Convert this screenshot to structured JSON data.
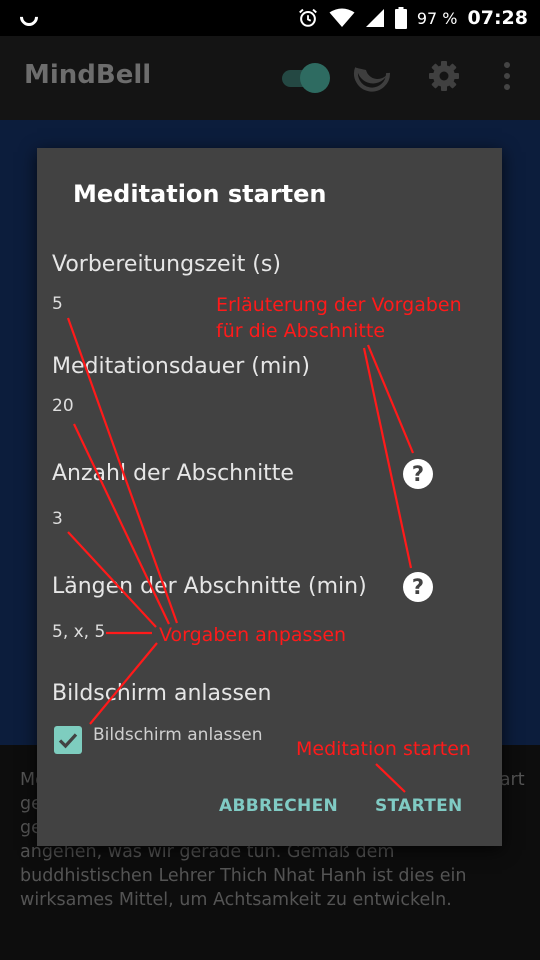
{
  "status_bar": {
    "battery_percent": "97 %",
    "time": "07:28"
  },
  "app_bar": {
    "title": "MindBell"
  },
  "background_text": "Meditation ist eine Übung, die im Alltag in der Gegenwart geschieht. Wir sind immer damit beschäftigt, was wir gerade tun, und in welchem Geisteszustand wir das angehen, was wir gerade tun. Gemäß dem buddhistischen Lehrer Thich Nhat Hanh ist dies ein wirksames Mittel, um Achtsamkeit zu entwickeln.",
  "dialog": {
    "title": "Meditation starten",
    "prefs": [
      {
        "title": "Vorbereitungszeit (s)",
        "value": "5"
      },
      {
        "title": "Meditationsdauer (min)",
        "value": "20"
      },
      {
        "title": "Anzahl der Abschnitte",
        "value": "3"
      },
      {
        "title": "Längen der Abschnitte (min)",
        "value": "5, x, 5"
      },
      {
        "title": "Bildschirm anlassen"
      }
    ],
    "checkbox_label": "Bildschirm anlassen",
    "checkbox_checked": true,
    "cancel_label": "ABBRECHEN",
    "start_label": "STARTEN"
  },
  "annotations": {
    "explanation_line1": "Erläuterung der Vorgaben",
    "explanation_line2": "für die Abschnitte",
    "adjust_defaults": "Vorgaben anpassen",
    "start_meditation": "Meditation starten"
  },
  "colors": {
    "accent": "#80cbc4",
    "dialog_bg": "#424242",
    "annotation": "#ff1a1a"
  }
}
